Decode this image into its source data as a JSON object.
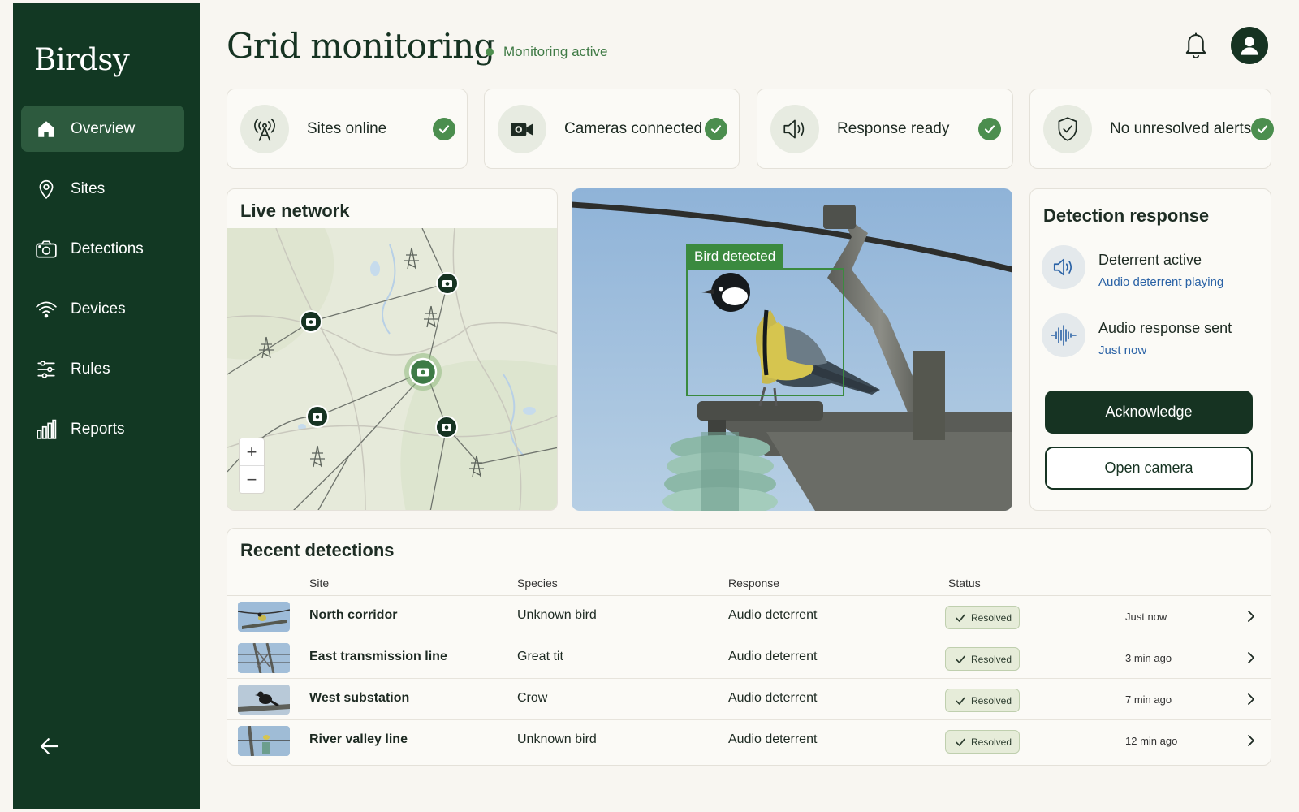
{
  "app": {
    "brand": "Birdsy"
  },
  "sidebar": {
    "items": [
      {
        "label": "Overview",
        "icon": "home-icon",
        "active": true
      },
      {
        "label": "Sites",
        "icon": "map-pin-icon"
      },
      {
        "label": "Detections",
        "icon": "camera-icon"
      },
      {
        "label": "Devices",
        "icon": "wifi-icon"
      },
      {
        "label": "Rules",
        "icon": "sliders-icon"
      },
      {
        "label": "Reports",
        "icon": "bar-chart-icon"
      }
    ],
    "collapse_icon": "arrow-left-icon"
  },
  "header": {
    "title": "Grid monitoring",
    "status": "Monitoring active",
    "status_color": "#4e8f4f"
  },
  "stats": [
    {
      "label": "Sites online",
      "icon": "antenna-icon"
    },
    {
      "label": "Cameras connected",
      "icon": "video-camera-icon"
    },
    {
      "label": "Response ready",
      "icon": "speaker-icon"
    },
    {
      "label": "No unresolved alerts",
      "icon": "shield-check-icon"
    }
  ],
  "live_network": {
    "title": "Live network",
    "zoom_in": "+",
    "zoom_out": "−"
  },
  "camera": {
    "detection_label": "Bird detected"
  },
  "detection_response": {
    "title": "Detection response",
    "items": [
      {
        "title": "Deterrent active",
        "subtitle": "Audio deterrent playing",
        "icon": "speaker-icon"
      },
      {
        "title": "Audio response sent",
        "subtitle": "Just now",
        "icon": "soundwave-icon"
      }
    ],
    "acknowledge": "Acknowledge",
    "open_camera": "Open camera"
  },
  "recent": {
    "title": "Recent detections",
    "columns": {
      "site": "Site",
      "species": "Species",
      "response": "Response",
      "status": "Status"
    },
    "rows": [
      {
        "site": "North corridor",
        "species": "Unknown bird",
        "response": "Audio deterrent",
        "status": "Resolved",
        "time": "Just now"
      },
      {
        "site": "East transmission line",
        "species": "Great tit",
        "response": "Audio deterrent",
        "status": "Resolved",
        "time": "3 min ago"
      },
      {
        "site": "West substation",
        "species": "Crow",
        "response": "Audio deterrent",
        "status": "Resolved",
        "time": "7 min ago"
      },
      {
        "site": "River valley line",
        "species": "Unknown bird",
        "response": "Audio deterrent",
        "status": "Resolved",
        "time": "12 min ago"
      }
    ]
  },
  "colors": {
    "sidebar": "#123823",
    "accent": "#163322",
    "success": "#4b8e4e",
    "link": "#2b63a6"
  }
}
